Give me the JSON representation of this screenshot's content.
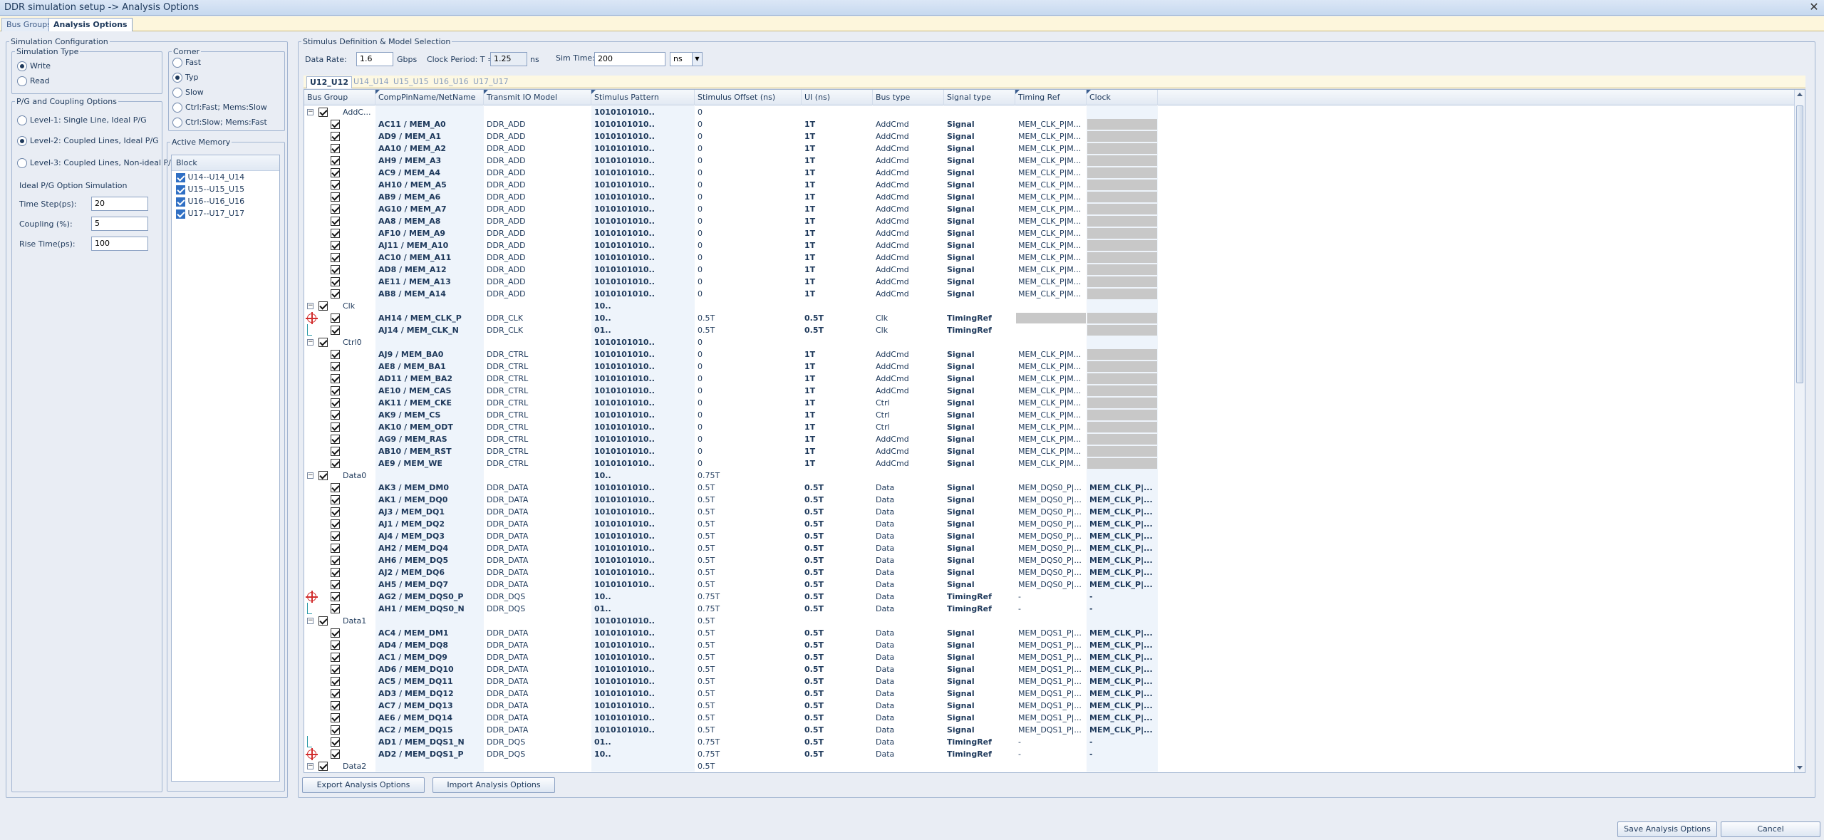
{
  "window": {
    "title": "DDR simulation setup -> Analysis Options",
    "close": "✕"
  },
  "tabs": [
    "Bus Groups",
    "Analysis Options"
  ],
  "sim_config": {
    "legend": "Simulation Configuration",
    "sim_type": {
      "legend": "Simulation Type",
      "options": [
        "Write",
        "Read"
      ],
      "selected": "Write"
    },
    "corner": {
      "legend": "Corner",
      "options": [
        "Fast",
        "Typ",
        "Slow",
        "Ctrl:Fast; Mems:Slow",
        "Ctrl:Slow; Mems:Fast"
      ],
      "selected": "Typ"
    },
    "pg": {
      "legend": "P/G and Coupling Options",
      "options": [
        "Level-1: Single Line, Ideal P/G",
        "Level-2: Coupled Lines, Ideal P/G",
        "Level-3: Coupled Lines, Non-ideal P/G"
      ],
      "selected": "Level-2: Coupled Lines, Ideal P/G",
      "ideal_title": "Ideal P/G Option Simulation",
      "fields": [
        {
          "label": "Time Step(ps):",
          "value": "20"
        },
        {
          "label": "Coupling (%):",
          "value": "5"
        },
        {
          "label": "Rise Time(ps):",
          "value": "100"
        }
      ]
    },
    "active_memory": {
      "legend": "Active Memory",
      "header": "Block",
      "items": [
        "U14--U14_U14",
        "U15--U15_U15",
        "U16--U16_U16",
        "U17--U17_U17"
      ]
    }
  },
  "stimulus": {
    "legend": "Stimulus Definition & Model Selection",
    "data_rate_label": "Data Rate:",
    "data_rate": "1.6",
    "data_rate_unit": "Gbps",
    "clock_label": "Clock Period: T =",
    "clock": "1.25",
    "clock_unit": "ns",
    "simtime_label": "Sim Time:",
    "simtime": "200",
    "simtime_unit": "ns",
    "sub_tabs": [
      "U12_U12",
      "U14_U14",
      "U15_U15",
      "U16_U16",
      "U17_U17"
    ],
    "columns": [
      "Bus Group",
      "CompPinName/NetName",
      "Transmit IO Model",
      "Stimulus Pattern",
      "Stimulus Offset (ns)",
      "UI (ns)",
      "Bus type",
      "Signal type",
      "Timing Ref",
      "Clock"
    ]
  },
  "rows": [
    {
      "g": "AddC...",
      "pat": "1010101010..",
      "off": "0"
    },
    {
      "p": "AC11 / MEM_A0",
      "m": "DDR_ADD",
      "pat": "1010101010..",
      "off": "0",
      "ui": "1T",
      "bt": "AddCmd",
      "st": "Signal",
      "tr": "MEM_CLK_P|M...",
      "ck": "gray"
    },
    {
      "p": "AD9 / MEM_A1",
      "m": "DDR_ADD",
      "pat": "1010101010..",
      "off": "0",
      "ui": "1T",
      "bt": "AddCmd",
      "st": "Signal",
      "tr": "MEM_CLK_P|M...",
      "ck": "gray"
    },
    {
      "p": "AA10 / MEM_A2",
      "m": "DDR_ADD",
      "pat": "1010101010..",
      "off": "0",
      "ui": "1T",
      "bt": "AddCmd",
      "st": "Signal",
      "tr": "MEM_CLK_P|M...",
      "ck": "gray"
    },
    {
      "p": "AH9 / MEM_A3",
      "m": "DDR_ADD",
      "pat": "1010101010..",
      "off": "0",
      "ui": "1T",
      "bt": "AddCmd",
      "st": "Signal",
      "tr": "MEM_CLK_P|M...",
      "ck": "gray"
    },
    {
      "p": "AC9 / MEM_A4",
      "m": "DDR_ADD",
      "pat": "1010101010..",
      "off": "0",
      "ui": "1T",
      "bt": "AddCmd",
      "st": "Signal",
      "tr": "MEM_CLK_P|M...",
      "ck": "gray"
    },
    {
      "p": "AH10 / MEM_A5",
      "m": "DDR_ADD",
      "pat": "1010101010..",
      "off": "0",
      "ui": "1T",
      "bt": "AddCmd",
      "st": "Signal",
      "tr": "MEM_CLK_P|M...",
      "ck": "gray"
    },
    {
      "p": "AB9 / MEM_A6",
      "m": "DDR_ADD",
      "pat": "1010101010..",
      "off": "0",
      "ui": "1T",
      "bt": "AddCmd",
      "st": "Signal",
      "tr": "MEM_CLK_P|M...",
      "ck": "gray"
    },
    {
      "p": "AG10 / MEM_A7",
      "m": "DDR_ADD",
      "pat": "1010101010..",
      "off": "0",
      "ui": "1T",
      "bt": "AddCmd",
      "st": "Signal",
      "tr": "MEM_CLK_P|M...",
      "ck": "gray"
    },
    {
      "p": "AA8 / MEM_A8",
      "m": "DDR_ADD",
      "pat": "1010101010..",
      "off": "0",
      "ui": "1T",
      "bt": "AddCmd",
      "st": "Signal",
      "tr": "MEM_CLK_P|M...",
      "ck": "gray"
    },
    {
      "p": "AF10 / MEM_A9",
      "m": "DDR_ADD",
      "pat": "1010101010..",
      "off": "0",
      "ui": "1T",
      "bt": "AddCmd",
      "st": "Signal",
      "tr": "MEM_CLK_P|M...",
      "ck": "gray"
    },
    {
      "p": "AJ11 / MEM_A10",
      "m": "DDR_ADD",
      "pat": "1010101010..",
      "off": "0",
      "ui": "1T",
      "bt": "AddCmd",
      "st": "Signal",
      "tr": "MEM_CLK_P|M...",
      "ck": "gray"
    },
    {
      "p": "AC10 / MEM_A11",
      "m": "DDR_ADD",
      "pat": "1010101010..",
      "off": "0",
      "ui": "1T",
      "bt": "AddCmd",
      "st": "Signal",
      "tr": "MEM_CLK_P|M...",
      "ck": "gray"
    },
    {
      "p": "AD8 / MEM_A12",
      "m": "DDR_ADD",
      "pat": "1010101010..",
      "off": "0",
      "ui": "1T",
      "bt": "AddCmd",
      "st": "Signal",
      "tr": "MEM_CLK_P|M...",
      "ck": "gray"
    },
    {
      "p": "AE11 / MEM_A13",
      "m": "DDR_ADD",
      "pat": "1010101010..",
      "off": "0",
      "ui": "1T",
      "bt": "AddCmd",
      "st": "Signal",
      "tr": "MEM_CLK_P|M...",
      "ck": "gray"
    },
    {
      "p": "AB8 / MEM_A14",
      "m": "DDR_ADD",
      "pat": "1010101010..",
      "off": "0",
      "ui": "1T",
      "bt": "AddCmd",
      "st": "Signal",
      "tr": "MEM_CLK_P|M...",
      "ck": "gray"
    },
    {
      "g": "Clk",
      "pat": "10..",
      "off": ""
    },
    {
      "p": "AH14 / MEM_CLK_P",
      "m": "DDR_CLK",
      "pat": "10..",
      "off": "0.5T",
      "ui": "0.5T",
      "bt": "Clk",
      "st": "TimingRef",
      "tr": "gray",
      "ck": "gray",
      "mk": "marker"
    },
    {
      "p": "AJ14 / MEM_CLK_N",
      "m": "DDR_CLK",
      "pat": "01..",
      "off": "0.5T",
      "ui": "0.5T",
      "bt": "Clk",
      "st": "TimingRef",
      "tr": "",
      "ck": "gray",
      "mk": "tick"
    },
    {
      "g": "Ctrl0",
      "pat": "1010101010..",
      "off": "0"
    },
    {
      "p": "AJ9 / MEM_BA0",
      "m": "DDR_CTRL",
      "pat": "1010101010..",
      "off": "0",
      "ui": "1T",
      "bt": "AddCmd",
      "st": "Signal",
      "tr": "MEM_CLK_P|M...",
      "ck": "gray"
    },
    {
      "p": "AE8 / MEM_BA1",
      "m": "DDR_CTRL",
      "pat": "1010101010..",
      "off": "0",
      "ui": "1T",
      "bt": "AddCmd",
      "st": "Signal",
      "tr": "MEM_CLK_P|M...",
      "ck": "gray"
    },
    {
      "p": "AD11 / MEM_BA2",
      "m": "DDR_CTRL",
      "pat": "1010101010..",
      "off": "0",
      "ui": "1T",
      "bt": "AddCmd",
      "st": "Signal",
      "tr": "MEM_CLK_P|M...",
      "ck": "gray"
    },
    {
      "p": "AE10 / MEM_CAS",
      "m": "DDR_CTRL",
      "pat": "1010101010..",
      "off": "0",
      "ui": "1T",
      "bt": "AddCmd",
      "st": "Signal",
      "tr": "MEM_CLK_P|M...",
      "ck": "gray"
    },
    {
      "p": "AK11 / MEM_CKE",
      "m": "DDR_CTRL",
      "pat": "1010101010..",
      "off": "0",
      "ui": "1T",
      "bt": "Ctrl",
      "st": "Signal",
      "tr": "MEM_CLK_P|M...",
      "ck": "gray"
    },
    {
      "p": "AK9 / MEM_CS",
      "m": "DDR_CTRL",
      "pat": "1010101010..",
      "off": "0",
      "ui": "1T",
      "bt": "Ctrl",
      "st": "Signal",
      "tr": "MEM_CLK_P|M...",
      "ck": "gray"
    },
    {
      "p": "AK10 / MEM_ODT",
      "m": "DDR_CTRL",
      "pat": "1010101010..",
      "off": "0",
      "ui": "1T",
      "bt": "Ctrl",
      "st": "Signal",
      "tr": "MEM_CLK_P|M...",
      "ck": "gray"
    },
    {
      "p": "AG9 / MEM_RAS",
      "m": "DDR_CTRL",
      "pat": "1010101010..",
      "off": "0",
      "ui": "1T",
      "bt": "AddCmd",
      "st": "Signal",
      "tr": "MEM_CLK_P|M...",
      "ck": "gray"
    },
    {
      "p": "AB10 / MEM_RST",
      "m": "DDR_CTRL",
      "pat": "1010101010..",
      "off": "0",
      "ui": "1T",
      "bt": "AddCmd",
      "st": "Signal",
      "tr": "MEM_CLK_P|M...",
      "ck": "gray"
    },
    {
      "p": "AE9 / MEM_WE",
      "m": "DDR_CTRL",
      "pat": "1010101010..",
      "off": "0",
      "ui": "1T",
      "bt": "AddCmd",
      "st": "Signal",
      "tr": "MEM_CLK_P|M...",
      "ck": "gray"
    },
    {
      "g": "Data0",
      "pat": "10..",
      "off": "0.75T"
    },
    {
      "p": "AK3 / MEM_DM0",
      "m": "DDR_DATA",
      "pat": "1010101010..",
      "off": "0.5T",
      "ui": "0.5T",
      "bt": "Data",
      "st": "Signal",
      "tr": "MEM_DQS0_P|...",
      "ck": "MEM_CLK_P|..."
    },
    {
      "p": "AK1 / MEM_DQ0",
      "m": "DDR_DATA",
      "pat": "1010101010..",
      "off": "0.5T",
      "ui": "0.5T",
      "bt": "Data",
      "st": "Signal",
      "tr": "MEM_DQS0_P|...",
      "ck": "MEM_CLK_P|..."
    },
    {
      "p": "AJ3 / MEM_DQ1",
      "m": "DDR_DATA",
      "pat": "1010101010..",
      "off": "0.5T",
      "ui": "0.5T",
      "bt": "Data",
      "st": "Signal",
      "tr": "MEM_DQS0_P|...",
      "ck": "MEM_CLK_P|..."
    },
    {
      "p": "AJ1 / MEM_DQ2",
      "m": "DDR_DATA",
      "pat": "1010101010..",
      "off": "0.5T",
      "ui": "0.5T",
      "bt": "Data",
      "st": "Signal",
      "tr": "MEM_DQS0_P|...",
      "ck": "MEM_CLK_P|..."
    },
    {
      "p": "AJ4 / MEM_DQ3",
      "m": "DDR_DATA",
      "pat": "1010101010..",
      "off": "0.5T",
      "ui": "0.5T",
      "bt": "Data",
      "st": "Signal",
      "tr": "MEM_DQS0_P|...",
      "ck": "MEM_CLK_P|..."
    },
    {
      "p": "AH2 / MEM_DQ4",
      "m": "DDR_DATA",
      "pat": "1010101010..",
      "off": "0.5T",
      "ui": "0.5T",
      "bt": "Data",
      "st": "Signal",
      "tr": "MEM_DQS0_P|...",
      "ck": "MEM_CLK_P|..."
    },
    {
      "p": "AH6 / MEM_DQ5",
      "m": "DDR_DATA",
      "pat": "1010101010..",
      "off": "0.5T",
      "ui": "0.5T",
      "bt": "Data",
      "st": "Signal",
      "tr": "MEM_DQS0_P|...",
      "ck": "MEM_CLK_P|..."
    },
    {
      "p": "AJ2 / MEM_DQ6",
      "m": "DDR_DATA",
      "pat": "1010101010..",
      "off": "0.5T",
      "ui": "0.5T",
      "bt": "Data",
      "st": "Signal",
      "tr": "MEM_DQS0_P|...",
      "ck": "MEM_CLK_P|..."
    },
    {
      "p": "AH5 / MEM_DQ7",
      "m": "DDR_DATA",
      "pat": "1010101010..",
      "off": "0.5T",
      "ui": "0.5T",
      "bt": "Data",
      "st": "Signal",
      "tr": "MEM_DQS0_P|...",
      "ck": "MEM_CLK_P|..."
    },
    {
      "p": "AG2 / MEM_DQS0_P",
      "m": "DDR_DQS",
      "pat": "10..",
      "off": "0.75T",
      "ui": "0.5T",
      "bt": "Data",
      "st": "TimingRef",
      "tr": "-",
      "ck": "-",
      "mk": "marker"
    },
    {
      "p": "AH1 / MEM_DQS0_N",
      "m": "DDR_DQS",
      "pat": "01..",
      "off": "0.75T",
      "ui": "0.5T",
      "bt": "Data",
      "st": "TimingRef",
      "tr": "-",
      "ck": "-",
      "mk": "tick"
    },
    {
      "g": "Data1",
      "pat": "1010101010..",
      "off": "0.5T"
    },
    {
      "p": "AC4 / MEM_DM1",
      "m": "DDR_DATA",
      "pat": "1010101010..",
      "off": "0.5T",
      "ui": "0.5T",
      "bt": "Data",
      "st": "Signal",
      "tr": "MEM_DQS1_P|...",
      "ck": "MEM_CLK_P|..."
    },
    {
      "p": "AD4 / MEM_DQ8",
      "m": "DDR_DATA",
      "pat": "1010101010..",
      "off": "0.5T",
      "ui": "0.5T",
      "bt": "Data",
      "st": "Signal",
      "tr": "MEM_DQS1_P|...",
      "ck": "MEM_CLK_P|..."
    },
    {
      "p": "AC1 / MEM_DQ9",
      "m": "DDR_DATA",
      "pat": "1010101010..",
      "off": "0.5T",
      "ui": "0.5T",
      "bt": "Data",
      "st": "Signal",
      "tr": "MEM_DQS1_P|...",
      "ck": "MEM_CLK_P|..."
    },
    {
      "p": "AD6 / MEM_DQ10",
      "m": "DDR_DATA",
      "pat": "1010101010..",
      "off": "0.5T",
      "ui": "0.5T",
      "bt": "Data",
      "st": "Signal",
      "tr": "MEM_DQS1_P|...",
      "ck": "MEM_CLK_P|..."
    },
    {
      "p": "AC5 / MEM_DQ11",
      "m": "DDR_DATA",
      "pat": "1010101010..",
      "off": "0.5T",
      "ui": "0.5T",
      "bt": "Data",
      "st": "Signal",
      "tr": "MEM_DQS1_P|...",
      "ck": "MEM_CLK_P|..."
    },
    {
      "p": "AD3 / MEM_DQ12",
      "m": "DDR_DATA",
      "pat": "1010101010..",
      "off": "0.5T",
      "ui": "0.5T",
      "bt": "Data",
      "st": "Signal",
      "tr": "MEM_DQS1_P|...",
      "ck": "MEM_CLK_P|..."
    },
    {
      "p": "AC7 / MEM_DQ13",
      "m": "DDR_DATA",
      "pat": "1010101010..",
      "off": "0.5T",
      "ui": "0.5T",
      "bt": "Data",
      "st": "Signal",
      "tr": "MEM_DQS1_P|...",
      "ck": "MEM_CLK_P|..."
    },
    {
      "p": "AE6 / MEM_DQ14",
      "m": "DDR_DATA",
      "pat": "1010101010..",
      "off": "0.5T",
      "ui": "0.5T",
      "bt": "Data",
      "st": "Signal",
      "tr": "MEM_DQS1_P|...",
      "ck": "MEM_CLK_P|..."
    },
    {
      "p": "AC2 / MEM_DQ15",
      "m": "DDR_DATA",
      "pat": "1010101010..",
      "off": "0.5T",
      "ui": "0.5T",
      "bt": "Data",
      "st": "Signal",
      "tr": "MEM_DQS1_P|...",
      "ck": "MEM_CLK_P|..."
    },
    {
      "p": "AD1 / MEM_DQS1_N",
      "m": "DDR_DQS",
      "pat": "01..",
      "off": "0.75T",
      "ui": "0.5T",
      "bt": "Data",
      "st": "TimingRef",
      "tr": "-",
      "ck": "-",
      "mk": "tick"
    },
    {
      "p": "AD2 / MEM_DQS1_P",
      "m": "DDR_DQS",
      "pat": "10..",
      "off": "0.75T",
      "ui": "0.5T",
      "bt": "Data",
      "st": "TimingRef",
      "tr": "-",
      "ck": "-",
      "mk": "marker"
    },
    {
      "g": "Data2",
      "pat": "",
      "off": "0.5T"
    }
  ],
  "buttons": {
    "export": "Export Analysis Options",
    "import": "Import Analysis Options",
    "save": "Save Analysis Options",
    "cancel": "Cancel"
  }
}
